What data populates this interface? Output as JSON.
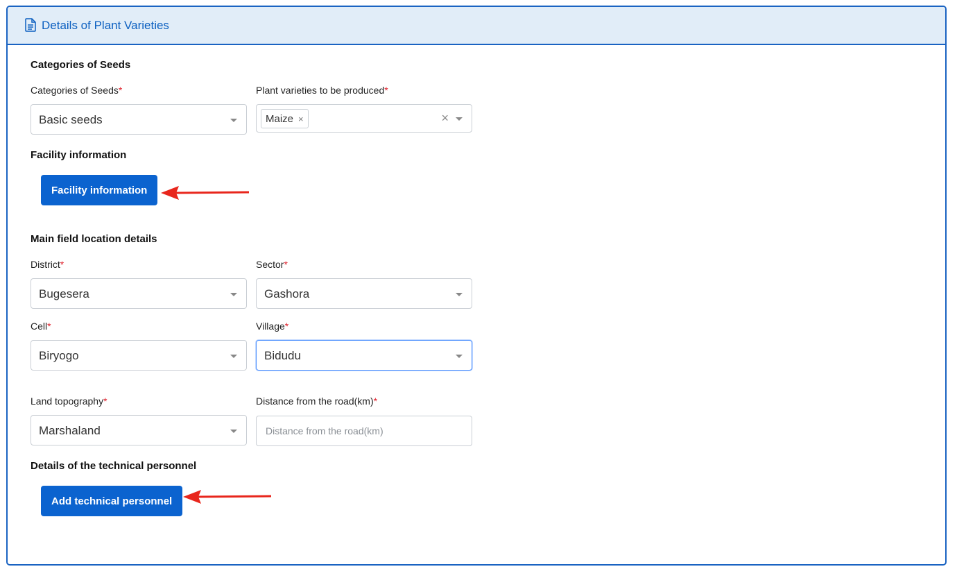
{
  "header": {
    "title": "Details of Plant Varieties",
    "icon": "document-icon"
  },
  "seeds": {
    "section_title": "Categories of Seeds",
    "category": {
      "label": "Categories of Seeds",
      "required_mark": "*",
      "value": "Basic seeds"
    },
    "varieties": {
      "label": "Plant varieties to be produced",
      "required_mark": "*",
      "chips": [
        "Maize"
      ],
      "chip_remove": "×",
      "clear": "×"
    }
  },
  "facility": {
    "section_title": "Facility information",
    "button_label": "Facility information"
  },
  "location": {
    "section_title": "Main field location details",
    "district": {
      "label": "District",
      "required_mark": "*",
      "value": "Bugesera"
    },
    "sector": {
      "label": "Sector",
      "required_mark": "*",
      "value": "Gashora"
    },
    "cell": {
      "label": "Cell",
      "required_mark": "*",
      "value": "Biryogo"
    },
    "village": {
      "label": "Village",
      "required_mark": "*",
      "value": "Bidudu"
    },
    "topography": {
      "label": "Land topography",
      "required_mark": "*",
      "value": "Marshaland"
    },
    "distance": {
      "label": "Distance from the road(km)",
      "required_mark": "*",
      "value": "",
      "placeholder": "Distance from the road(km)"
    }
  },
  "personnel": {
    "section_title": "Details of the technical personnel",
    "button_label": "Add technical personnel"
  },
  "colors": {
    "primary": "#0b63cf",
    "header_bg": "#e1edf8",
    "border": "#1a63c2",
    "required": "#e0232e",
    "annotation_arrow": "#e8261c"
  }
}
